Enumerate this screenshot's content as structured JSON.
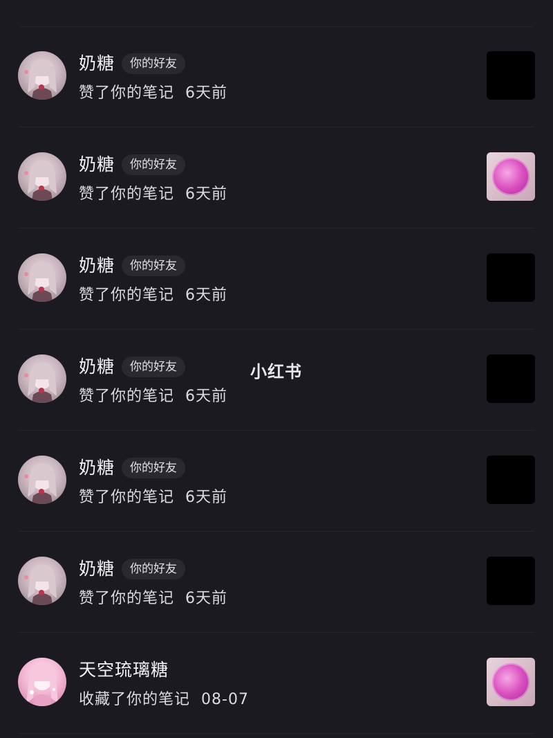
{
  "watermark": "小红书",
  "notifications": [
    {
      "name": "奶糖",
      "badge": "你的好友",
      "action": "赞了你的笔记",
      "time": "6天前",
      "thumb": "black"
    },
    {
      "name": "奶糖",
      "badge": "你的好友",
      "action": "赞了你的笔记",
      "time": "6天前",
      "thumb": "pink"
    },
    {
      "name": "奶糖",
      "badge": "你的好友",
      "action": "赞了你的笔记",
      "time": "6天前",
      "thumb": "black"
    },
    {
      "name": "奶糖",
      "badge": "你的好友",
      "action": "赞了你的笔记",
      "time": "6天前",
      "thumb": "black"
    },
    {
      "name": "奶糖",
      "badge": "你的好友",
      "action": "赞了你的笔记",
      "time": "6天前",
      "thumb": "black"
    },
    {
      "name": "奶糖",
      "badge": "你的好友",
      "action": "赞了你的笔记",
      "time": "6天前",
      "thumb": "black"
    },
    {
      "name": "天空琉璃糖",
      "badge": "",
      "action": "收藏了你的笔记",
      "time": "08-07",
      "thumb": "pink"
    }
  ],
  "colors": {
    "background": "#1b1a20",
    "divider": "#26252c",
    "badge_bg": "#2a2930"
  },
  "icons": {
    "avatar": "anime-avatar-icon",
    "thumb": "note-thumbnail"
  }
}
